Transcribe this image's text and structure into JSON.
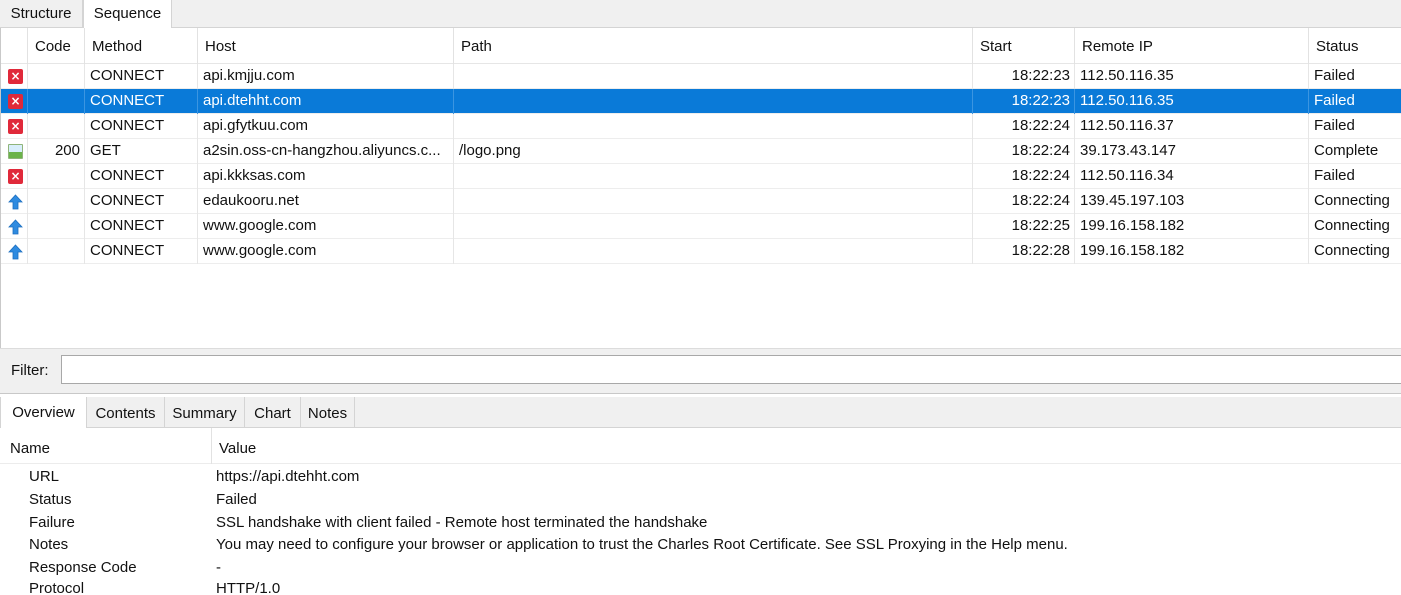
{
  "top_tabs": [
    "Structure",
    "Sequence"
  ],
  "columns": [
    "Code",
    "Method",
    "Host",
    "Path",
    "Start",
    "Remote IP",
    "Status"
  ],
  "rows": [
    {
      "icon": "failed-icon",
      "code": "",
      "method": "CONNECT",
      "host": "api.kmjju.com",
      "path": "",
      "start": "18:22:23",
      "remote_ip": "112.50.116.35",
      "status": "Failed"
    },
    {
      "icon": "failed-icon",
      "code": "",
      "method": "CONNECT",
      "host": "api.dtehht.com",
      "path": "",
      "start": "18:22:23",
      "remote_ip": "112.50.116.35",
      "status": "Failed",
      "selected": true
    },
    {
      "icon": "failed-icon",
      "code": "",
      "method": "CONNECT",
      "host": "api.gfytkuu.com",
      "path": "",
      "start": "18:22:24",
      "remote_ip": "112.50.116.37",
      "status": "Failed"
    },
    {
      "icon": "image-icon",
      "code": "200",
      "method": "GET",
      "host": "a2sin.oss-cn-hangzhou.aliyuncs.c...",
      "path": "/logo.png",
      "start": "18:22:24",
      "remote_ip": "39.173.43.147",
      "status": "Complete"
    },
    {
      "icon": "failed-icon",
      "code": "",
      "method": "CONNECT",
      "host": "api.kkksas.com",
      "path": "",
      "start": "18:22:24",
      "remote_ip": "112.50.116.34",
      "status": "Failed"
    },
    {
      "icon": "upload-arrow-icon",
      "code": "",
      "method": "CONNECT",
      "host": "edaukooru.net",
      "path": "",
      "start": "18:22:24",
      "remote_ip": "139.45.197.103",
      "status": "Connecting"
    },
    {
      "icon": "upload-arrow-icon",
      "code": "",
      "method": "CONNECT",
      "host": "www.google.com",
      "path": "",
      "start": "18:22:25",
      "remote_ip": "199.16.158.182",
      "status": "Connecting"
    },
    {
      "icon": "upload-arrow-icon",
      "code": "",
      "method": "CONNECT",
      "host": "www.google.com",
      "path": "",
      "start": "18:22:28",
      "remote_ip": "199.16.158.182",
      "status": "Connecting"
    }
  ],
  "filter": {
    "label": "Filter:",
    "value": ""
  },
  "bottom_tabs": [
    "Overview",
    "Contents",
    "Summary",
    "Chart",
    "Notes"
  ],
  "details": {
    "columns": [
      "Name",
      "Value"
    ],
    "rows": [
      {
        "name": "URL",
        "value": "https://api.dtehht.com"
      },
      {
        "name": "Status",
        "value": "Failed"
      },
      {
        "name": "Failure",
        "value": "SSL handshake with client failed - Remote host terminated the handshake"
      },
      {
        "name": "Notes",
        "value": "You may need to configure your browser or application to trust the Charles Root Certificate. See SSL Proxying in the Help menu."
      },
      {
        "name": "Response Code",
        "value": "-"
      },
      {
        "name": "Protocol",
        "value": "HTTP/1.0"
      }
    ]
  },
  "colors": {
    "selection": "#0a7ad8",
    "failed": "#e0293a",
    "upload_arrow": "#2f8be0"
  }
}
